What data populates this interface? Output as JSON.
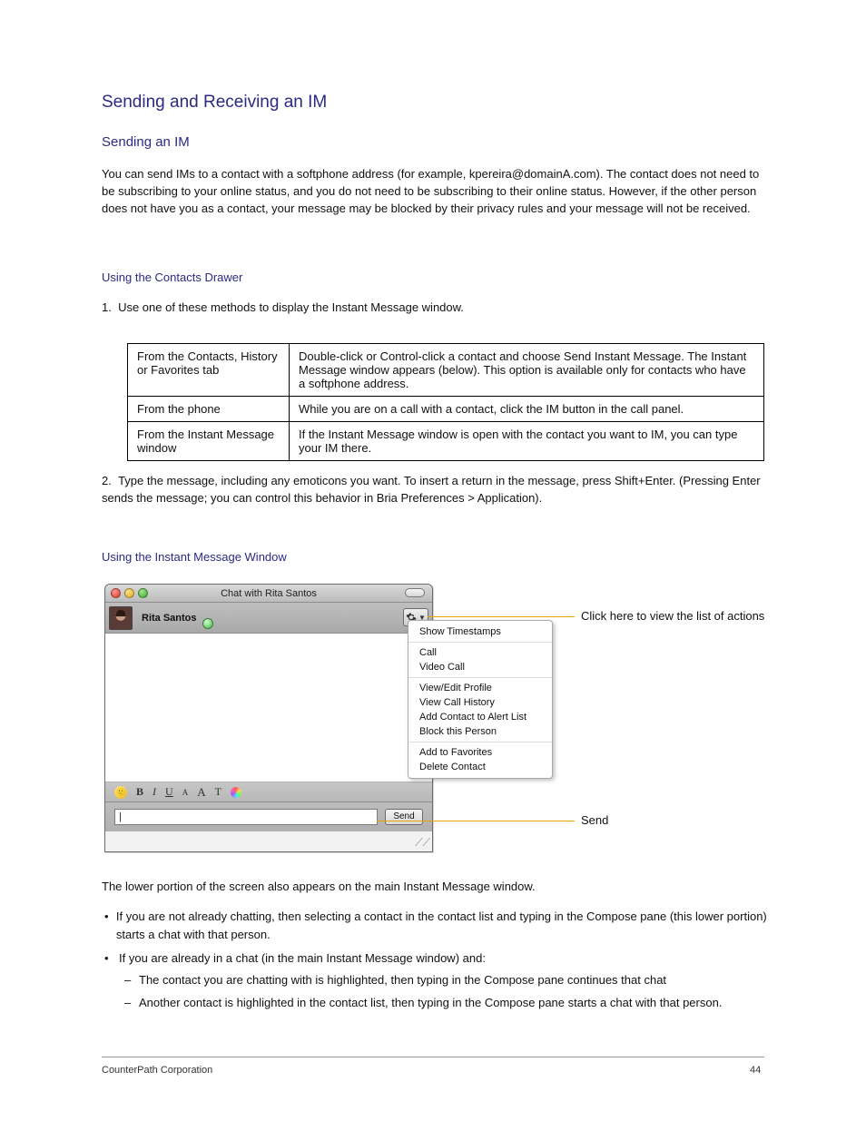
{
  "headings": {
    "h2": "Sending and Receiving an IM",
    "h3": "Sending an IM",
    "h4_first": "Using the Contacts Drawer",
    "h4_second": "Using the Instant Message Window"
  },
  "intro": "You can send IMs to a contact with a softphone address (for example, kpereira@domainA.com). The contact does not need to be subscribing to your online status, and you do not need to be subscribing to their online status. However, if the other person does not have you as a contact, your message may be blocked by their privacy rules and your message will not be received.",
  "table": {
    "r1k": "From the Contacts, History or Favorites tab",
    "r1v": "Double-click or Control-click a contact and choose Send Instant Message. The Instant Message window appears (below). This option is available only for contacts who have a softphone address.",
    "r2k": "From the phone",
    "r2v": "While you are on a call with a contact, click the IM button in the call panel.",
    "r3k": "From the Instant Message window",
    "r3v": "If the Instant Message window is open with the contact you want to IM, you can type your IM there."
  },
  "steps_intro": "Use one of these methods to display the Instant Message window.",
  "after_table": "Type the message, including any emoticons you want. To insert a return in the message, press Shift+Enter. (Pressing Enter sends the message; you can control this behavior in Bria Preferences > Application).",
  "chat": {
    "windowTitle": "Chat with Rita Santos",
    "contactName": "Rita Santos",
    "sendLabel": "Send",
    "msgCaret": "|",
    "fmt": {
      "b": "B",
      "i": "I",
      "u": "U",
      "asm": "A",
      "abig": "A",
      "t": "T"
    }
  },
  "menu": {
    "items": [
      "Show Timestamps",
      "Call",
      "Video Call",
      "View/Edit Profile",
      "View Call History",
      "Add Contact to Alert List",
      "Block this Person",
      "Add to Favorites",
      "Delete Contact"
    ]
  },
  "callouts": {
    "top": "Click here to view the list of actions",
    "bottom": "Send"
  },
  "below": {
    "line1": "The lower portion of the screen also appears on the main Instant Message window.",
    "bullets": [
      "If you are not already chatting, then selecting a contact in the contact list and typing in the Compose pane (this lower portion) starts a chat with that person.",
      "If you are already in a chat (in the main Instant Message window) and:",
      "The contact you are chatting with is highlighted, then typing in the Compose pane continues that chat",
      "Another contact is highlighted in the contact list, then typing in the Compose pane starts a chat with that person."
    ]
  },
  "footer": {
    "left": "CounterPath Corporation",
    "right": "44"
  }
}
